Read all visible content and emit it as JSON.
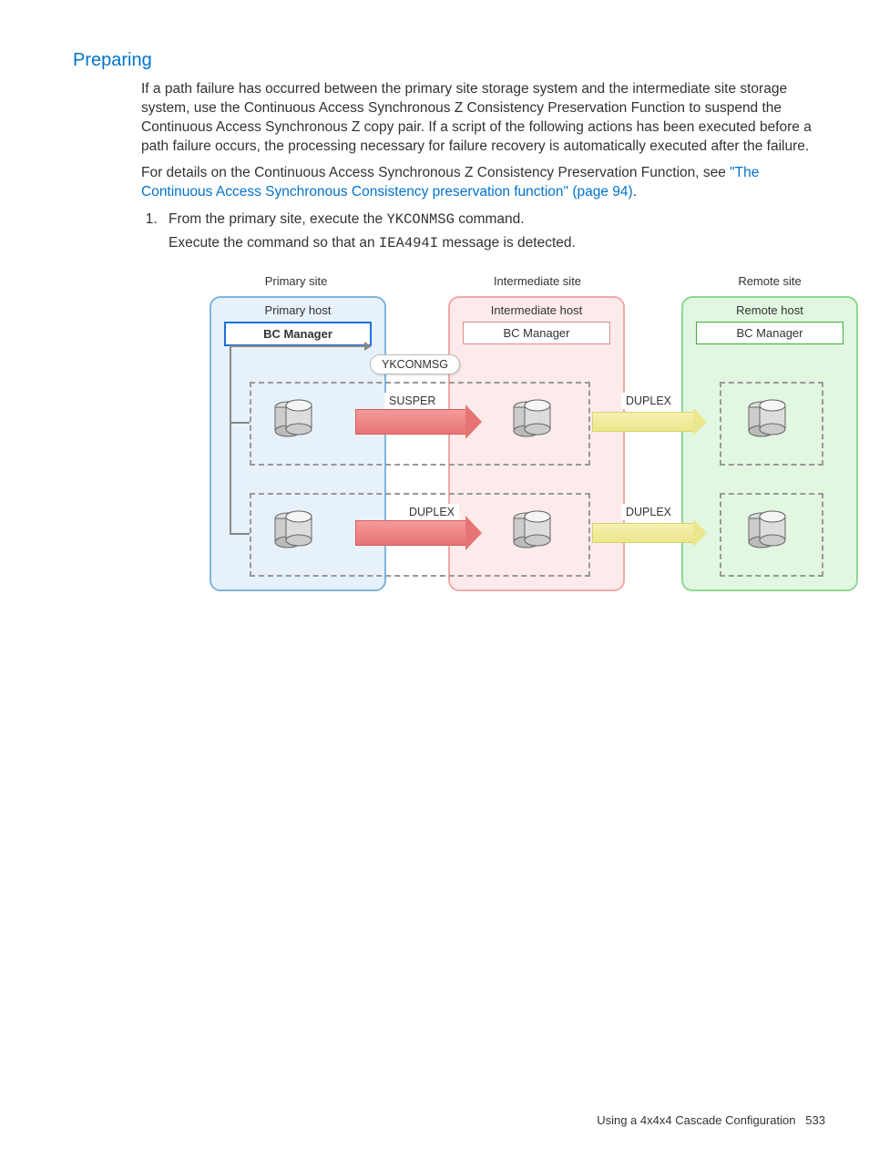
{
  "section_title": "Preparing",
  "para1": "If a path failure has occurred between the primary site storage system and the intermediate site storage system, use the Continuous Access Synchronous Z Consistency Preservation Function to suspend the Continuous Access Synchronous Z copy pair. If a script of the following actions has been executed before a path failure occurs, the processing necessary for failure recovery is automatically executed after the failure.",
  "para2_prefix": "For details on the Continuous Access Synchronous Z Consistency Preservation Function, see ",
  "para2_link": "\"The Continuous Access Synchronous Consistency preservation function\" (page 94)",
  "para2_suffix": ".",
  "step1_prefix": "From the primary site, execute the ",
  "step1_code": "YKCONMSG",
  "step1_suffix": " command.",
  "step1b_prefix": "Execute the command so that an ",
  "step1b_code": "IEA494I",
  "step1b_suffix": " message is detected.",
  "diagram": {
    "sites": {
      "primary": "Primary site",
      "intermediate": "Intermediate site",
      "remote": "Remote site"
    },
    "hosts": {
      "primary": "Primary host",
      "intermediate": "Intermediate host",
      "remote": "Remote host"
    },
    "bc_manager": "BC Manager",
    "command": "YKCONMSG",
    "states": {
      "susper": "SUSPER",
      "duplex": "DUPLEX"
    }
  },
  "footer": {
    "text": "Using a 4x4x4 Cascade Configuration",
    "page": "533"
  }
}
